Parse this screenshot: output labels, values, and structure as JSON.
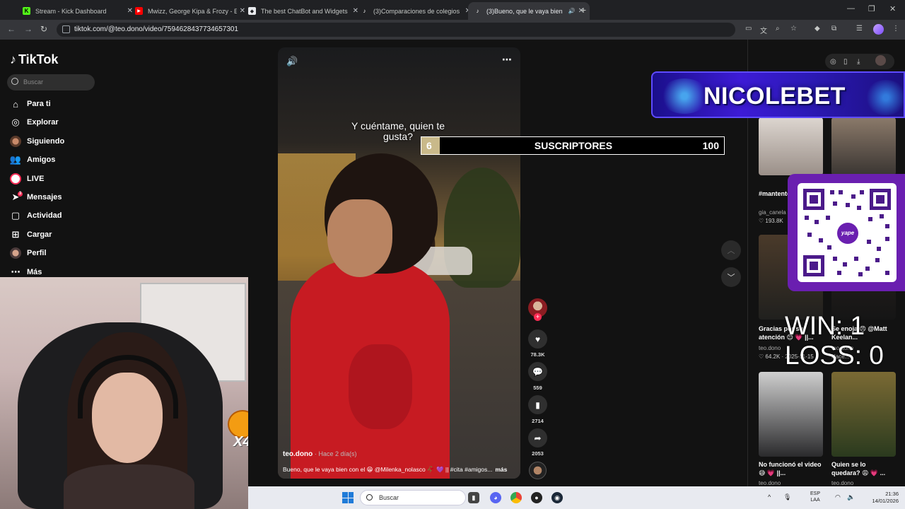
{
  "browser": {
    "tabs": [
      {
        "label": "Stream - Kick Dashboard",
        "icon": "kick-icon",
        "color": "#53fc18"
      },
      {
        "label": "Mwizz, George Kipa & Frozy - E",
        "icon": "youtube-icon",
        "color": "#ff0000"
      },
      {
        "label": "The best ChatBot and Widgets",
        "icon": "streamelements-icon",
        "color": "#ffffff"
      },
      {
        "label": "(3)Comparaciones de colegios",
        "icon": "tiktok-icon",
        "color": "#ffffff"
      },
      {
        "label": "(3)Bueno, que le vaya bien",
        "icon": "tiktok-icon",
        "color": "#ffffff",
        "active": true
      }
    ],
    "url": "tiktok.com/@teo.dono/video/7594628437734657301"
  },
  "tiktok": {
    "logo": "TikTok",
    "search_placeholder": "Buscar",
    "nav": [
      {
        "label": "Para ti",
        "icon": "home-icon"
      },
      {
        "label": "Explorar",
        "icon": "compass-icon"
      },
      {
        "label": "Siguiendo",
        "icon": "following-avatar-icon"
      },
      {
        "label": "Amigos",
        "icon": "friends-icon"
      },
      {
        "label": "LIVE",
        "icon": "live-icon"
      },
      {
        "label": "Mensajes",
        "icon": "messages-icon",
        "badge": "3"
      },
      {
        "label": "Actividad",
        "icon": "activity-icon"
      },
      {
        "label": "Cargar",
        "icon": "upload-icon"
      },
      {
        "label": "Perfil",
        "icon": "profile-avatar-icon"
      },
      {
        "label": "Más",
        "icon": "more-icon"
      }
    ],
    "video": {
      "overlay_text": "Y cuéntame, quien te gusta?",
      "author": "teo.dono",
      "posted": "· Hace 2 día(s)",
      "description": "Bueno, que le vaya bien con el 😁 @Milenka_nolasco 🥀 💜 || #cita #amigos...",
      "more": "más"
    },
    "actions": {
      "likes": "78.3K",
      "comments": "559",
      "saves": "2714",
      "shares": "2053"
    },
    "suggestions": [
      {
        "caption": "#mantento ntapa",
        "user": "gia_canela",
        "stat": "♡ 193.8K"
      },
      {
        "caption": "",
        "user": "",
        "stat": ""
      },
      {
        "caption": "Gracias por su atención 😊 💗 ||...",
        "user": "teo.dono",
        "stat": "♡ 64.2K · 2025-11-15"
      },
      {
        "caption": "Se enoja 😠 @Matt Keelan...",
        "user": "teo.dono",
        "stat": "Hace..."
      },
      {
        "caption": "No funcionó el video 😅 💗 ||...",
        "user": "teo.dono",
        "stat": ""
      },
      {
        "caption": "Quien se lo quedara? 😩 💗 ...",
        "user": "teo.dono",
        "stat": ""
      }
    ]
  },
  "overlays": {
    "sponsor": "NICOLEBET",
    "subs": {
      "current": "6",
      "label": "SUSCRIPTORES",
      "goal": "100",
      "progress": 0.06
    },
    "qr_brand": "yape",
    "win_line": "WIN: 1",
    "loss_line": "LOSS: 0",
    "multiplier": "X4"
  },
  "taskbar": {
    "search": "Buscar",
    "lang_top": "ESP",
    "lang_bottom": "LAA",
    "time": "21:36",
    "date": "14/01/2026"
  }
}
